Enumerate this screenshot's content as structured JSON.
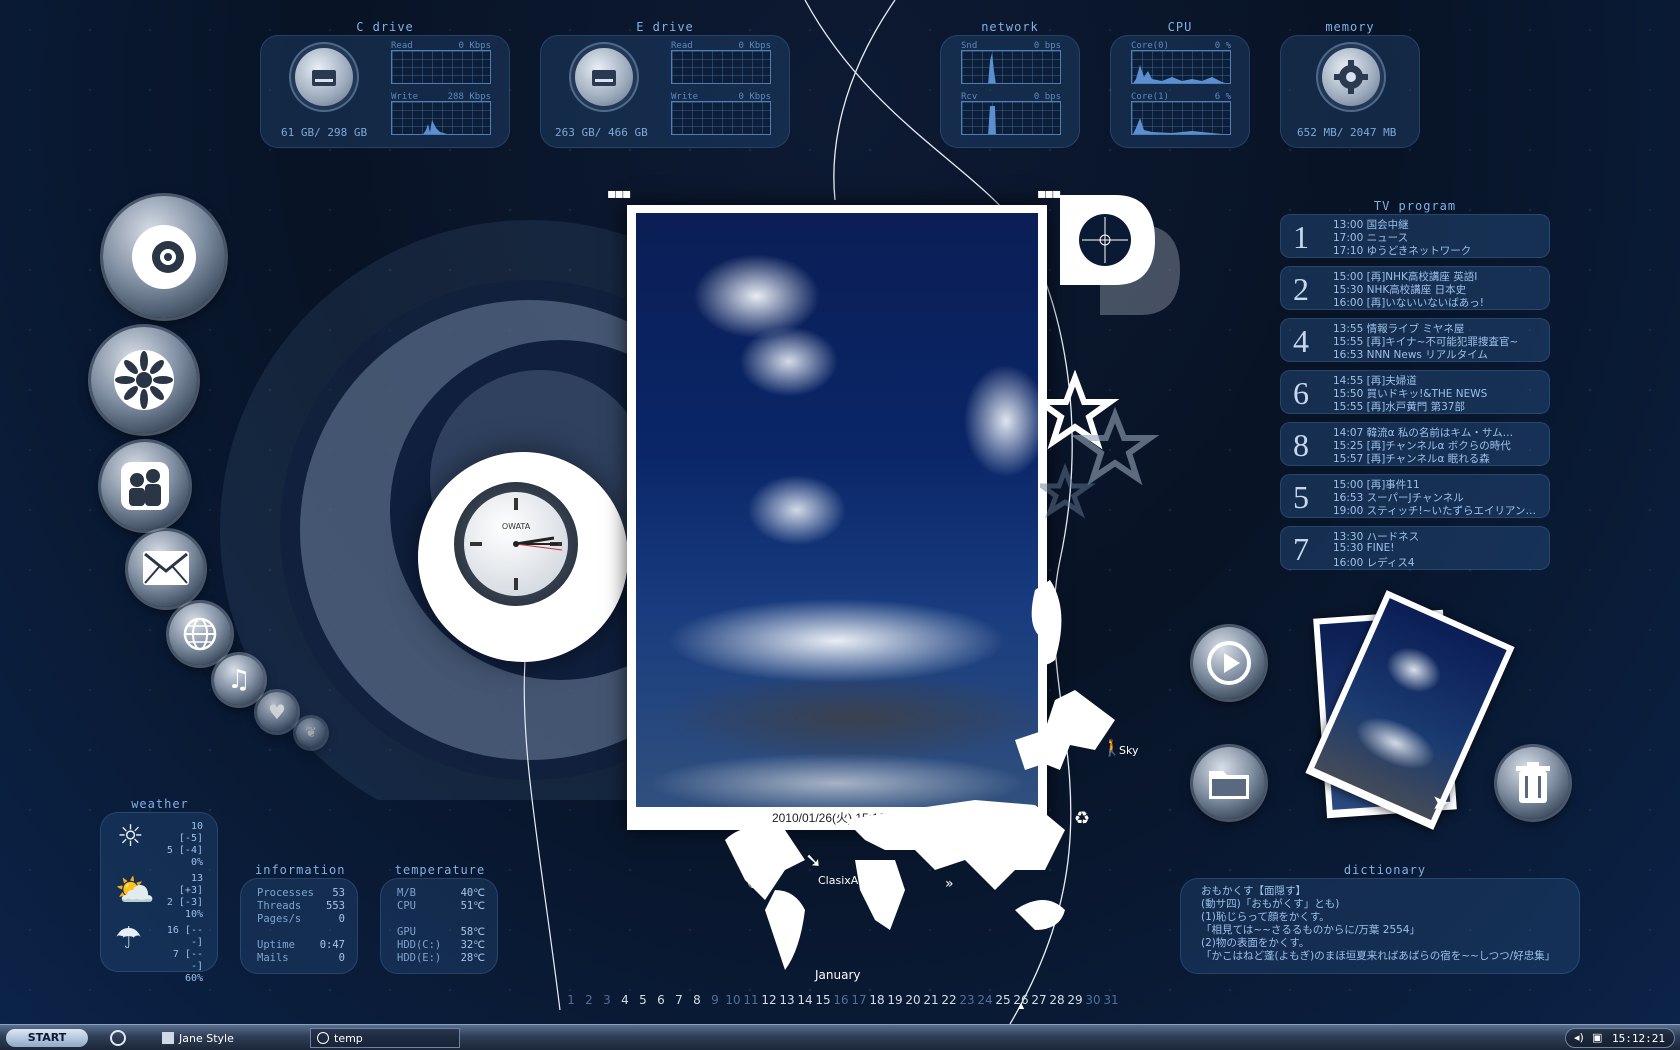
{
  "drives": [
    {
      "title": "C drive",
      "read_label": "Read",
      "read_rate": "0 Kbps",
      "write_label": "Write",
      "write_rate": "288 Kbps",
      "usage": "61 GB/ 298 GB"
    },
    {
      "title": "E drive",
      "read_label": "Read",
      "read_rate": "0 Kbps",
      "write_label": "Write",
      "write_rate": "0 Kbps",
      "usage": "263 GB/ 466 GB"
    }
  ],
  "network": {
    "title": "network",
    "snd_label": "Snd",
    "snd_rate": "0 bps",
    "rcv_label": "Rcv",
    "rcv_rate": "0 bps"
  },
  "cpu": {
    "title": "CPU",
    "core0_label": "Core(0)",
    "core0_value": "0 %",
    "core1_label": "Core(1)",
    "core1_value": "6 %"
  },
  "memory": {
    "title": "memory",
    "usage": "652 MB/ 2047 MB"
  },
  "clock": {
    "brand": "OWATA"
  },
  "photo": {
    "timestamp": "2010/01/26(火) 15:12:21"
  },
  "map": {
    "sky_label": "Sky",
    "clasix_label": "ClasixArt",
    "month": "January"
  },
  "tv": {
    "title": "TV program",
    "rows": [
      {
        "ch": "1",
        "lines": [
          "13:00 国会中継",
          "17:00 ニュース",
          "17:10 ゆうどきネットワーク"
        ]
      },
      {
        "ch": "2",
        "lines": [
          "15:00 [再]NHK高校講座 英語Ⅰ",
          "15:30 NHK高校講座 日本史",
          "16:00 [再]いないいないばあっ!"
        ]
      },
      {
        "ch": "4",
        "lines": [
          "13:55 情報ライブ ミヤネ屋",
          "15:55 [再]キイナ~不可能犯罪捜査官~",
          "16:53 NNN News リアルタイム"
        ]
      },
      {
        "ch": "6",
        "lines": [
          "14:55 [再]夫婦道",
          "15:50 買いドキッ!&THE NEWS",
          "15:55 [再]水戸黄門 第37部"
        ]
      },
      {
        "ch": "8",
        "lines": [
          "14:07 韓流α 私の名前はキム・サム…",
          "15:25 [再]チャンネルα ボクらの時代",
          "15:57 [再]チャンネルα 眠れる森"
        ]
      },
      {
        "ch": "5",
        "lines": [
          "15:00 [再]事件11",
          "16:53 スーパーJチャンネル",
          "19:00 スティッチ!~いたずらエイリアン…"
        ]
      },
      {
        "ch": "7",
        "lines": [
          "13:30 ハードネス",
          "15:30 FINE!",
          "16:00 レディス4"
        ]
      }
    ]
  },
  "weather": {
    "title": "weather",
    "days": [
      {
        "icon": "sun-icon",
        "high": "10 [-5]",
        "low": "5 [-4]",
        "pop": "0%"
      },
      {
        "icon": "partly-cloudy-icon",
        "high": "13 [+3]",
        "low": "2 [-3]",
        "pop": "10%"
      },
      {
        "icon": "rain-icon",
        "high": "16 [---]",
        "low": "7 [---]",
        "pop": "60%"
      }
    ]
  },
  "information": {
    "title": "information",
    "rows": [
      {
        "label": "Processes",
        "value": "53"
      },
      {
        "label": "Threads",
        "value": "553"
      },
      {
        "label": "Pages/s",
        "value": "0"
      },
      {
        "label": "Uptime",
        "value": "0:47"
      },
      {
        "label": "Mails",
        "value": "0"
      }
    ]
  },
  "temperature": {
    "title": "temperature",
    "rows": [
      {
        "label": "M/B",
        "value": "40℃"
      },
      {
        "label": "CPU",
        "value": "51℃"
      },
      {
        "label": "GPU",
        "value": "58℃"
      },
      {
        "label": "HDD(C:)",
        "value": "32℃"
      },
      {
        "label": "HDD(E:)",
        "value": "28℃"
      }
    ]
  },
  "dictionary": {
    "title": "dictionary",
    "lines": [
      "おもかくす【面隠す】",
      "(動サ四)「おもがくす」とも)",
      "(1)恥じらって顔をかくす。",
      "「相見ては~~さるるものからに/万葉 2554」",
      "(2)物の表面をかくす。",
      "「かこはねど蓬(よもぎ)のまほ垣夏来ればあばらの宿を~~しつつ/好忠集」"
    ]
  },
  "calendar": {
    "days": [
      "1",
      "2",
      "3",
      "4",
      "5",
      "6",
      "7",
      "8",
      "9",
      "10",
      "11",
      "12",
      "13",
      "14",
      "15",
      "16",
      "17",
      "18",
      "19",
      "20",
      "21",
      "22",
      "23",
      "24",
      "25",
      "26",
      "27",
      "28",
      "29",
      "30",
      "31"
    ],
    "today": "26"
  },
  "taskbar": {
    "start": "START",
    "items": [
      "Jane Style",
      "temp"
    ],
    "time": "15:12:21"
  }
}
